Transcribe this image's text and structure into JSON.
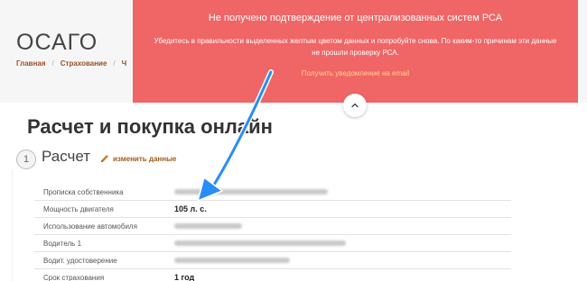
{
  "header": {
    "title": "ОСАГО",
    "breadcrumb": [
      "Главная",
      "Страхование",
      "Ч"
    ]
  },
  "main": {
    "section_title": "Расчет и покупка онлайн",
    "step": {
      "number": "1",
      "title": "Расчет",
      "edit_label": "изменить данные"
    },
    "table": [
      {
        "label": "Прописка собственника",
        "value": ""
      },
      {
        "label": "Мощность двигателя",
        "value": "105 л. с."
      },
      {
        "label": "Использование автомобиля",
        "value": ""
      },
      {
        "label": "Водитель 1",
        "value": ""
      },
      {
        "label": "Водит. удостоверение",
        "value": ""
      },
      {
        "label": "Срок страхования",
        "value": "1 год"
      }
    ]
  },
  "alert": {
    "title": "Не получено подтверждение от централизованных систем РСА",
    "body": "Убедитесь в правильности выделенных желтым цветом данных и попробуйте снова. По каким-то причинам эти данные не прошли проверку РСА.",
    "link": "Получить уведомление на email",
    "colors": {
      "background": "#f06565",
      "link": "#ffd78a"
    },
    "collapse_icon": "chevron-up-icon"
  },
  "annotation": {
    "type": "arrow",
    "color": "#2a8df5"
  }
}
